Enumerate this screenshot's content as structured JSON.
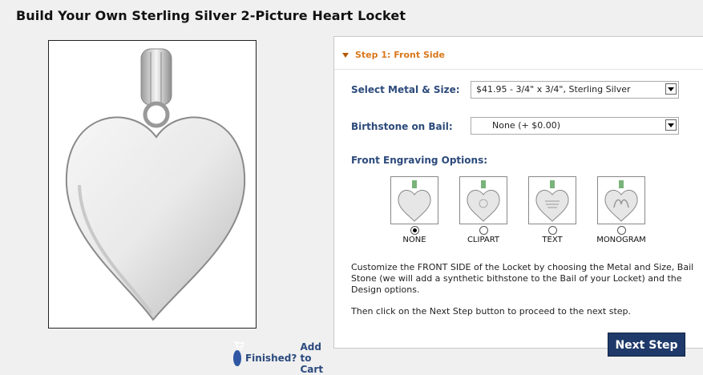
{
  "page": {
    "title": "Build Your Own Sterling Silver 2-Picture Heart Locket"
  },
  "preview": {
    "finish_text": "Finished?",
    "cart_text": "Add to Cart"
  },
  "step": {
    "title": "Step 1: Front Side"
  },
  "metal": {
    "label": "Select Metal & Size:",
    "value": "$41.95 - 3/4\" x 3/4\", Sterling Silver"
  },
  "birthstone": {
    "label": "Birthstone on Bail:",
    "value": "None (+ $0.00)"
  },
  "engraving": {
    "label": "Front Engraving Options:",
    "options": [
      {
        "label": "NONE",
        "selected": true
      },
      {
        "label": "CLIPART",
        "selected": false
      },
      {
        "label": "TEXT",
        "selected": false
      },
      {
        "label": "MONOGRAM",
        "selected": false
      }
    ]
  },
  "description": {
    "main": "Customize the FRONT SIDE of the Locket by choosing the Metal and Size, Bail Stone (we will add a synthetic bithstone to the Bail of your Locket) and the Design options.",
    "next_hint": "Then click on the Next Step button to proceed to the next step."
  },
  "next_button": {
    "label": "Next Step"
  }
}
